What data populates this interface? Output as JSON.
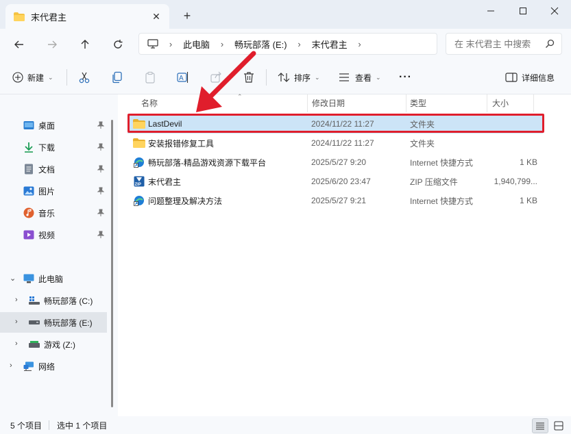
{
  "tab": {
    "title": "末代君主",
    "close": "✕",
    "new": "+"
  },
  "window_controls": {
    "minimize": "—",
    "maximize": "☐",
    "close": "✕"
  },
  "nav": {
    "back": "←",
    "forward": "→",
    "up": "↑",
    "refresh": "⟳"
  },
  "address": {
    "computer_icon": "monitor-icon",
    "crumbs": [
      "此电脑",
      "畅玩部落 (E:)",
      "末代君主"
    ],
    "sep": "›"
  },
  "search": {
    "placeholder": "在 末代君主 中搜索"
  },
  "toolbar": {
    "new_label": "新建",
    "sort_label": "排序",
    "view_label": "查看",
    "more_label": "···",
    "details_label": "详细信息"
  },
  "sidebar": {
    "quick_access": [
      {
        "label": "桌面",
        "icon": "desktop-icon",
        "color": "#2c7fd1"
      },
      {
        "label": "下载",
        "icon": "download-icon",
        "color": "#1e9e58"
      },
      {
        "label": "文档",
        "icon": "document-icon",
        "color": "#6b7b8c"
      },
      {
        "label": "图片",
        "icon": "picture-icon",
        "color": "#2a7ad5"
      },
      {
        "label": "音乐",
        "icon": "music-icon",
        "color": "#e0612f"
      },
      {
        "label": "视频",
        "icon": "video-icon",
        "color": "#8a4fd0"
      }
    ],
    "this_pc": "此电脑",
    "drives": [
      {
        "label": "畅玩部落 (C:)",
        "icon": "windows-drive-icon"
      },
      {
        "label": "畅玩部落 (E:)",
        "icon": "drive-icon",
        "selected": true
      },
      {
        "label": "游戏 (Z:)",
        "icon": "drive-green-icon"
      }
    ],
    "network": "网络"
  },
  "columns": {
    "name": "名称",
    "date": "修改日期",
    "type": "类型",
    "size": "大小"
  },
  "files": [
    {
      "name": "LastDevil",
      "date": "2024/11/22 11:27",
      "type": "文件夹",
      "size": "",
      "icon": "folder-icon",
      "selected": true
    },
    {
      "name": "安装报错修复工具",
      "date": "2024/11/22 11:27",
      "type": "文件夹",
      "size": "",
      "icon": "folder-icon"
    },
    {
      "name": "畅玩部落-精品游戏资源下载平台",
      "date": "2025/5/27 9:20",
      "type": "Internet 快捷方式",
      "size": "1 KB",
      "icon": "internet-shortcut-icon"
    },
    {
      "name": "末代君主",
      "date": "2025/6/20 23:47",
      "type": "ZIP 压缩文件",
      "size": "1,940,799...",
      "icon": "zip-icon"
    },
    {
      "name": "问题整理及解决方法",
      "date": "2025/5/27 9:21",
      "type": "Internet 快捷方式",
      "size": "1 KB",
      "icon": "internet-shortcut-icon"
    }
  ],
  "status": {
    "count": "5 个项目",
    "selected": "选中 1 个项目"
  },
  "colors": {
    "highlight_red": "#e01e2c",
    "selection_blue": "#cce4f7",
    "folder_yellow": "#f5c343"
  }
}
